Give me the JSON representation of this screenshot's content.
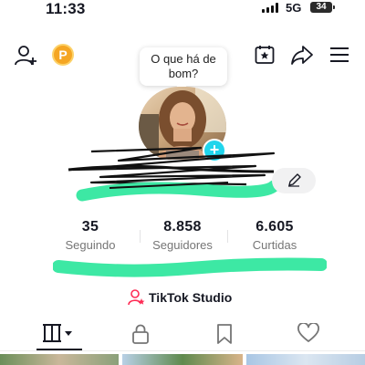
{
  "status_bar": {
    "time": "11:33",
    "network": "5G",
    "battery": "34"
  },
  "header": {
    "bubble_text": "O que há de bom?"
  },
  "stats": [
    {
      "value": "35",
      "label": "Seguindo"
    },
    {
      "value": "8.858",
      "label": "Seguidores"
    },
    {
      "value": "6.605",
      "label": "Curtidas"
    }
  ],
  "studio_label": "TikTok Studio",
  "colors": {
    "accent_cyan": "#20d5ec",
    "coin": "#f5a623",
    "scribble_green": "#3de8a4",
    "studio_pink": "#fe2c55"
  }
}
